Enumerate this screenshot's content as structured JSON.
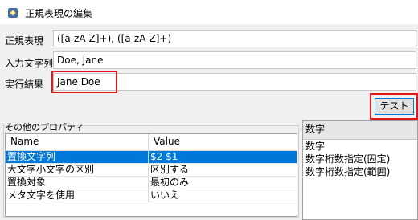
{
  "window": {
    "title": "正規表現の編集",
    "icon": "regex-editor-icon"
  },
  "form": {
    "regex_label": "正規表現",
    "regex_value": "([a-zA-Z]+), ([a-zA-Z]+)",
    "input_label": "入力文字列",
    "input_value": "Doe, Jane",
    "result_label": "実行結果",
    "result_value": "Jane Doe"
  },
  "test_button": {
    "label": "テスト"
  },
  "properties": {
    "title": "その他のプロパティ",
    "columns": [
      "Name",
      "Value"
    ],
    "rows": [
      {
        "name": "置換文字列",
        "value": "$2 $1",
        "selected": true
      },
      {
        "name": "大文字小文字の区別",
        "value": "区別する"
      },
      {
        "name": "置換対象",
        "value": "最初のみ"
      },
      {
        "name": "メタ文字を使用",
        "value": "いいえ"
      }
    ]
  },
  "side_panel": {
    "header": "数字",
    "items": [
      "数字",
      "数字桁数指定(固定)",
      "数字桁数指定(範囲)"
    ]
  },
  "colors": {
    "highlight": "#e3161c",
    "selection": "#0078d7"
  }
}
